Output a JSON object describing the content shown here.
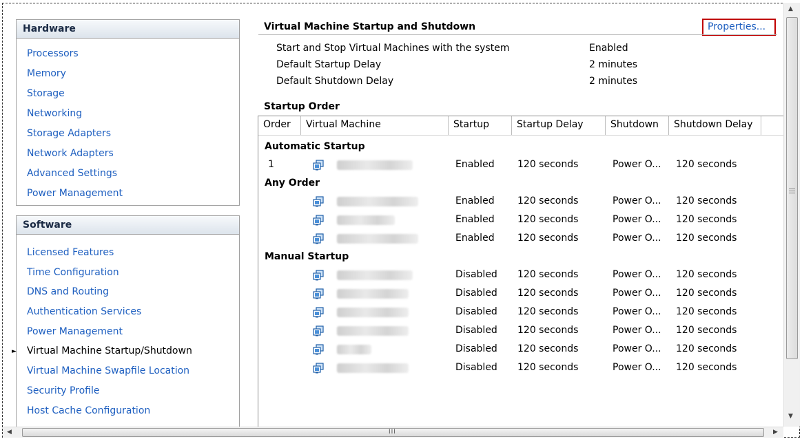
{
  "hardware": {
    "title": "Hardware",
    "items": [
      "Processors",
      "Memory",
      "Storage",
      "Networking",
      "Storage Adapters",
      "Network Adapters",
      "Advanced Settings",
      "Power Management"
    ]
  },
  "software": {
    "title": "Software",
    "items": [
      "Licensed Features",
      "Time Configuration",
      "DNS and Routing",
      "Authentication Services",
      "Power Management",
      "Virtual Machine Startup/Shutdown",
      "Virtual Machine Swapfile Location",
      "Security Profile",
      "Host Cache Configuration"
    ],
    "current": "Virtual Machine Startup/Shutdown"
  },
  "main": {
    "title": "Virtual Machine Startup and Shutdown",
    "properties_link": "Properties...",
    "settings": [
      {
        "label": "Start and Stop Virtual Machines with the system",
        "value": "Enabled"
      },
      {
        "label": "Default Startup Delay",
        "value": "2 minutes"
      },
      {
        "label": "Default Shutdown Delay",
        "value": "2 minutes"
      }
    ],
    "startup_order_title": "Startup Order"
  },
  "table": {
    "columns": [
      "Order",
      "Virtual Machine",
      "Startup",
      "Startup Delay",
      "Shutdown",
      "Shutdown Delay"
    ],
    "groups": [
      {
        "name": "Automatic Startup",
        "rows": [
          {
            "order": "1",
            "startup": "Enabled",
            "startup_delay": "120 seconds",
            "shutdown": "Power O...",
            "shutdown_delay": "120 seconds"
          }
        ]
      },
      {
        "name": "Any Order",
        "rows": [
          {
            "order": "",
            "startup": "Enabled",
            "startup_delay": "120 seconds",
            "shutdown": "Power O...",
            "shutdown_delay": "120 seconds"
          },
          {
            "order": "",
            "startup": "Enabled",
            "startup_delay": "120 seconds",
            "shutdown": "Power O...",
            "shutdown_delay": "120 seconds"
          },
          {
            "order": "",
            "startup": "Enabled",
            "startup_delay": "120 seconds",
            "shutdown": "Power O...",
            "shutdown_delay": "120 seconds"
          }
        ]
      },
      {
        "name": "Manual Startup",
        "rows": [
          {
            "order": "",
            "startup": "Disabled",
            "startup_delay": "120 seconds",
            "shutdown": "Power O...",
            "shutdown_delay": "120 seconds"
          },
          {
            "order": "",
            "startup": "Disabled",
            "startup_delay": "120 seconds",
            "shutdown": "Power O...",
            "shutdown_delay": "120 seconds"
          },
          {
            "order": "",
            "startup": "Disabled",
            "startup_delay": "120 seconds",
            "shutdown": "Power O...",
            "shutdown_delay": "120 seconds"
          },
          {
            "order": "",
            "startup": "Disabled",
            "startup_delay": "120 seconds",
            "shutdown": "Power O...",
            "shutdown_delay": "120 seconds"
          },
          {
            "order": "",
            "startup": "Disabled",
            "startup_delay": "120 seconds",
            "shutdown": "Power O...",
            "shutdown_delay": "120 seconds"
          },
          {
            "order": "",
            "startup": "Disabled",
            "startup_delay": "120 seconds",
            "shutdown": "Power O...",
            "shutdown_delay": "120 seconds"
          }
        ]
      }
    ]
  },
  "scrollbar": {
    "h_grip": "III"
  },
  "icons": {
    "vm": "virtual-machine-icon",
    "scroll_up": "scroll-up-arrow-icon",
    "scroll_down": "scroll-down-arrow-icon",
    "scroll_left": "scroll-left-arrow-icon",
    "scroll_right": "scroll-right-arrow-icon"
  },
  "colors": {
    "link": "#1e5fc0",
    "highlight_border": "#c00000",
    "panel_header": "#dde4ec"
  }
}
